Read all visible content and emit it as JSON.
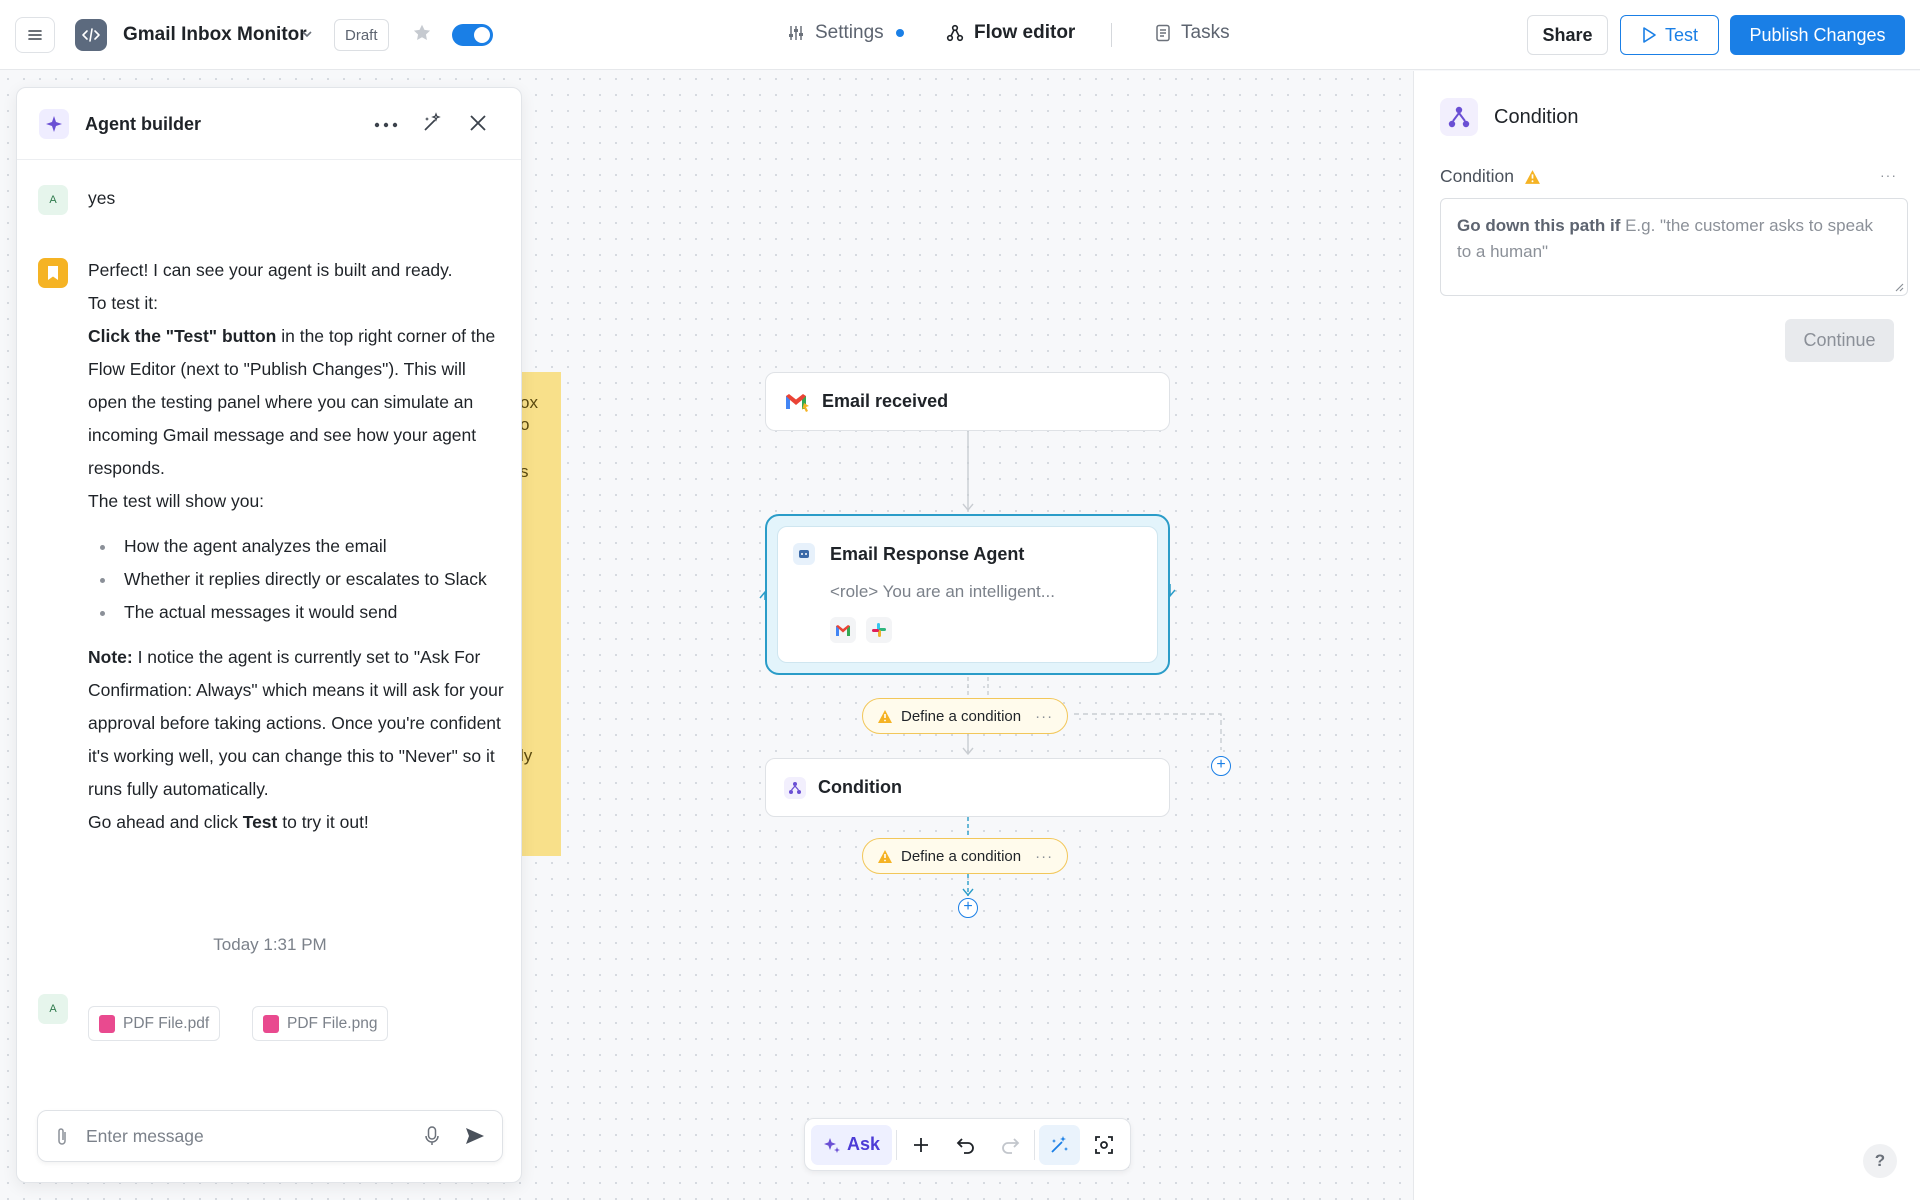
{
  "header": {
    "app_title": "Gmail Inbox Monitor",
    "status_badge": "Draft",
    "nav": {
      "settings": "Settings",
      "flow_editor": "Flow editor",
      "tasks": "Tasks"
    },
    "share_label": "Share",
    "test_label": "Test",
    "publish_label": "Publish Changes",
    "accent_color": "#1a7fe6"
  },
  "canvas": {
    "sticky_fragments": [
      "ox",
      "o",
      "s",
      "ly"
    ],
    "nodes": {
      "trigger": "Email received",
      "agent_title": "Email Response Agent",
      "agent_subtitle": "<role> You are an intelligent...",
      "condition": "Condition"
    },
    "pills": [
      "Define a condition",
      "Define a condition"
    ],
    "pill_more": "···"
  },
  "toolbar": {
    "ask_label": "Ask"
  },
  "agent_builder": {
    "title": "Agent builder",
    "user_avatar": "A",
    "user_message": "yes",
    "reply": {
      "p1": "Perfect! I can see your agent is built and ready.",
      "p2": "To test it:",
      "p3_bold": "Click the \"Test\" button",
      "p3_rest": " in the top right corner of the Flow Editor (next to \"Publish Changes\"). This will open the testing panel where you can simulate an incoming Gmail message and see how your agent responds.",
      "p4": "The test will show you:",
      "bullets": [
        "How the agent analyzes the email",
        "Whether it replies directly or escalates to Slack",
        "The actual messages it would send"
      ],
      "note_bold": "Note:",
      "note_rest": " I notice the agent is currently set to \"Ask For Confirmation: Always\" which means it will ask for your approval before taking actions. Once you're confident it's working well, you can change this to \"Never\" so it runs fully automatically.",
      "final_pre": "Go ahead and click ",
      "final_bold": "Test",
      "final_post": " to try it out!"
    },
    "timestamp": "Today 1:31 PM",
    "attachments": [
      "PDF File.pdf",
      "PDF File.png"
    ],
    "composer_placeholder": "Enter message"
  },
  "properties": {
    "title": "Condition",
    "field_label": "Condition",
    "field_more": "···",
    "textarea_lead": "Go down this path if",
    "textarea_placeholder": " E.g. \"the customer asks to speak to a human\"",
    "continue_label": "Continue"
  },
  "help_label": "?"
}
